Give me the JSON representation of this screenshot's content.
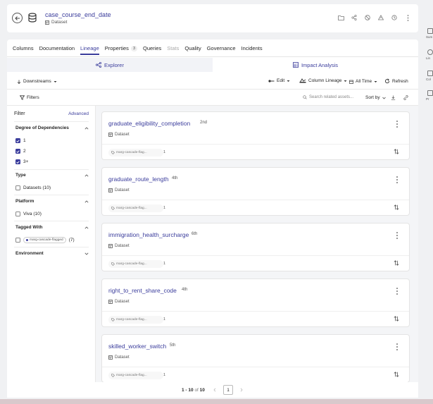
{
  "header": {
    "entity_name": "case_course_end_date",
    "entity_type": "Dataset"
  },
  "tabs": [
    {
      "label": "Columns"
    },
    {
      "label": "Documentation"
    },
    {
      "label": "Lineage"
    },
    {
      "label": "Properties",
      "count": "3"
    },
    {
      "label": "Queries"
    },
    {
      "label": "Stats"
    },
    {
      "label": "Quality"
    },
    {
      "label": "Governance"
    },
    {
      "label": "Incidents"
    }
  ],
  "subtabs": {
    "explorer": "Explorer",
    "impact": "Impact Analysis"
  },
  "toolbar": {
    "direction": "Downstreams",
    "edit": "Edit",
    "column_lineage": "Column Lineage",
    "time_range": "All Time",
    "refresh": "Refresh"
  },
  "filterbar": {
    "filters": "Filters",
    "search_placeholder": "Search related assets...",
    "sort_by": "Sort by"
  },
  "sidebar": {
    "title": "Filter",
    "advanced": "Advanced",
    "sections": {
      "degree": "Degree of Dependencies",
      "type": "Type",
      "platform": "Platform",
      "tagged_with": "Tagged With",
      "environment": "Environment"
    },
    "degree_options": [
      "1",
      "2",
      "3+"
    ],
    "type_option": "Datasets (10)",
    "platform_option": "Viva (10)",
    "tag_option": "marg-cascade-flagged",
    "tag_count": "(7)"
  },
  "results": [
    {
      "name": "graduate_eligibility_completion",
      "degree": "2nd",
      "type": "Dataset",
      "tag": "marg-cascade-flag...",
      "count": "1"
    },
    {
      "name": "graduate_route_length",
      "degree": "4th",
      "type": "Dataset",
      "tag": "marg-cascade-flag...",
      "count": "1"
    },
    {
      "name": "immigration_health_surcharge",
      "degree": "6th",
      "type": "Dataset",
      "tag": "marg-cascade-flag...",
      "count": "1"
    },
    {
      "name": "right_to_rent_share_code",
      "degree": "4th",
      "type": "Dataset",
      "tag": "marg-cascade-flag...",
      "count": "1"
    },
    {
      "name": "skilled_worker_switch",
      "degree": "5th",
      "type": "Dataset",
      "tag": "marg-cascade-flag...",
      "count": "1"
    }
  ],
  "pagination": {
    "summary_range": "1 - 10",
    "summary_of": "of",
    "summary_total": "10",
    "current_page": "1"
  },
  "rail": [
    "Sum",
    "Lin",
    "Col",
    "Pr"
  ],
  "colors": {
    "accent": "#3b3d9c",
    "text": "#262626",
    "muted": "#555555",
    "bottom_strip": "#d9c9cc"
  }
}
